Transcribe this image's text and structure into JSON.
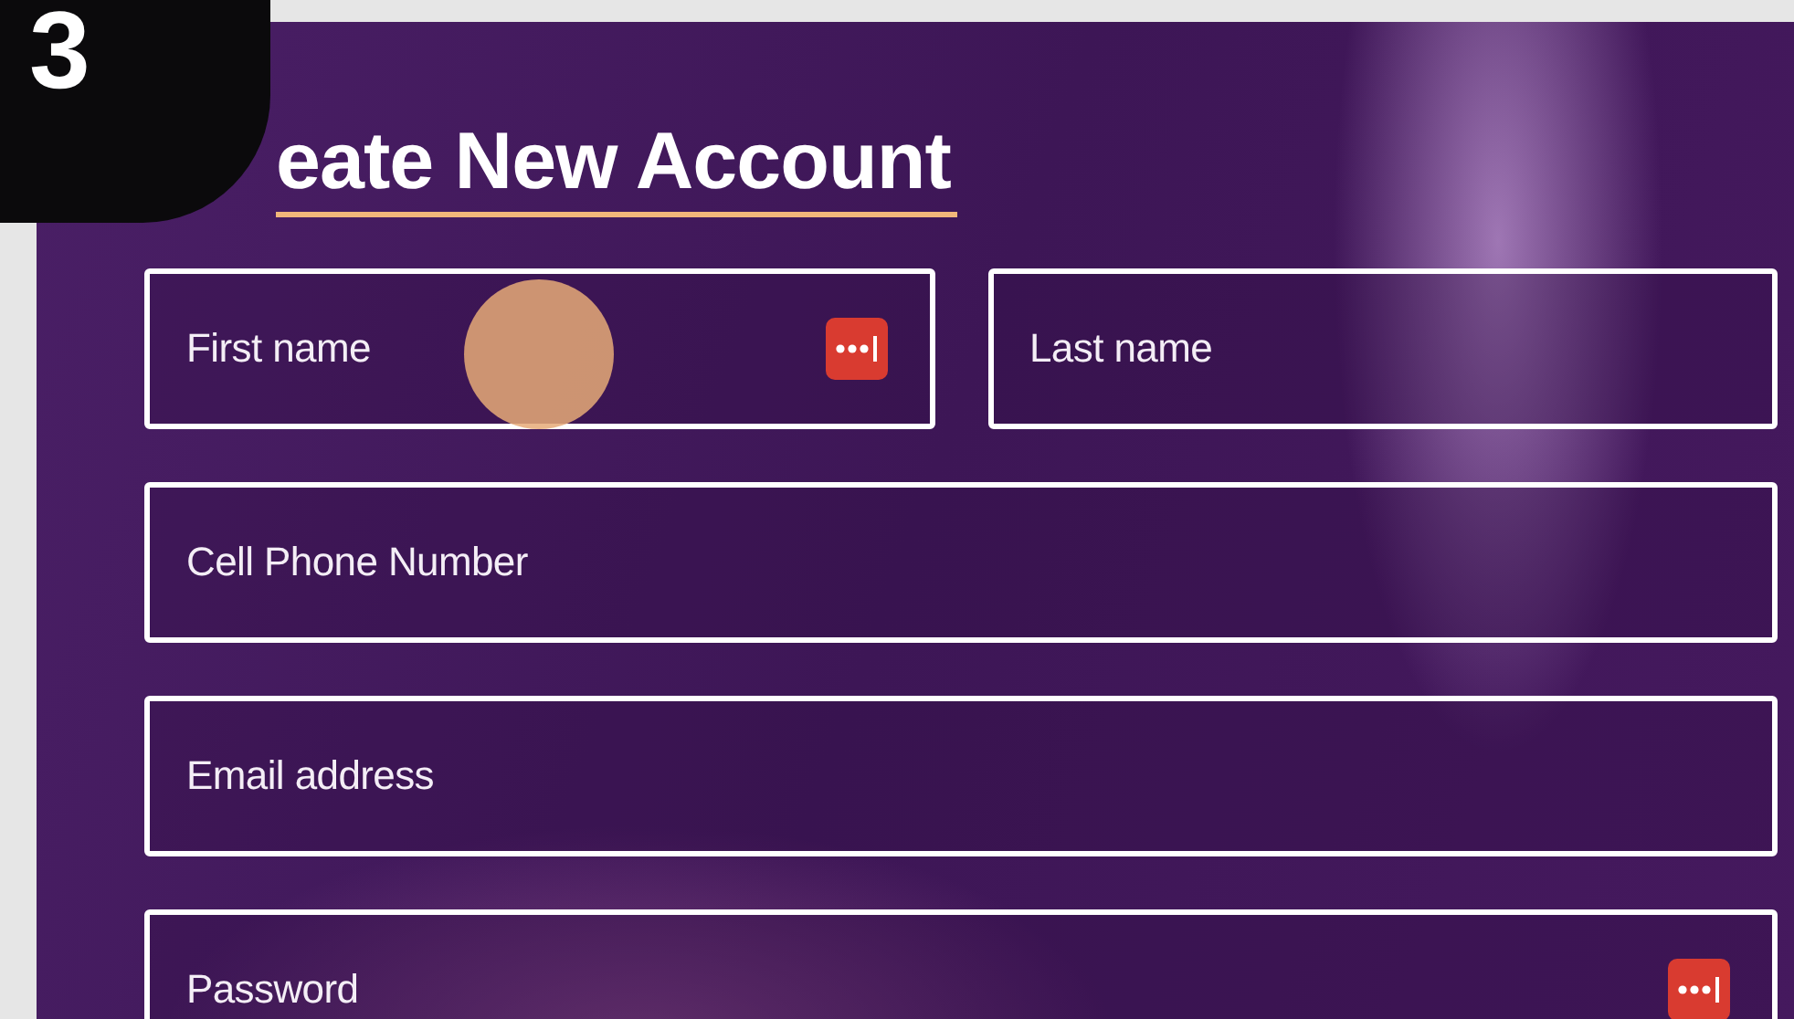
{
  "step_badge": "3",
  "title": "eate New Account",
  "rows": [
    [
      {
        "placeholder": "First name",
        "password_manager_icon": true,
        "touch_indicator": true
      },
      {
        "placeholder": "Last name",
        "password_manager_icon": false,
        "touch_indicator": false
      }
    ],
    [
      {
        "placeholder": "Cell Phone Number",
        "password_manager_icon": false,
        "touch_indicator": false
      }
    ],
    [
      {
        "placeholder": "Email address",
        "password_manager_icon": false,
        "touch_indicator": false
      }
    ],
    [
      {
        "placeholder": "Password",
        "password_manager_icon": true,
        "touch_indicator": false
      }
    ]
  ]
}
